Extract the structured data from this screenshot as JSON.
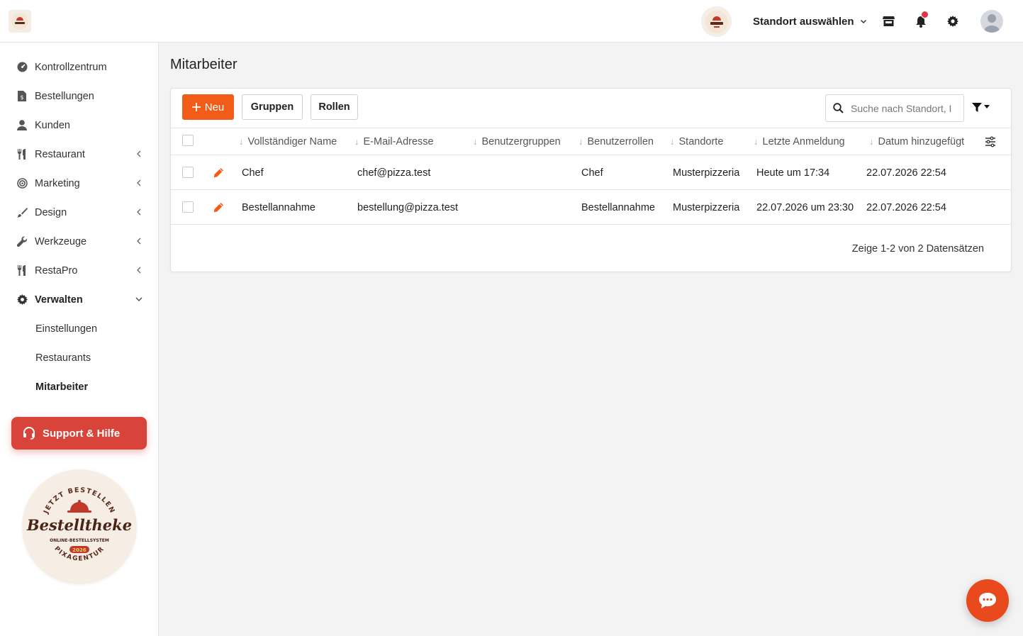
{
  "header": {
    "location_select_label": "Standort auswählen",
    "icons": [
      "store-icon",
      "bell-icon",
      "gear-icon",
      "user-avatar-icon"
    ],
    "notification_dot_color": "#dc3545"
  },
  "sidebar": {
    "items": [
      {
        "label": "Kontrollzentrum",
        "icon": "dashboard-icon"
      },
      {
        "label": "Bestellungen",
        "icon": "order-file-icon"
      },
      {
        "label": "Kunden",
        "icon": "user-icon"
      },
      {
        "label": "Restaurant",
        "icon": "utensils-icon"
      },
      {
        "label": "Marketing",
        "icon": "target-icon"
      },
      {
        "label": "Design",
        "icon": "brush-icon"
      },
      {
        "label": "Werkzeuge",
        "icon": "wrench-icon"
      },
      {
        "label": "RestaPro",
        "icon": "utensils-icon"
      },
      {
        "label": "Verwalten",
        "icon": "gear-icon"
      }
    ],
    "subitems": [
      {
        "label": "Einstellungen"
      },
      {
        "label": "Restaurants"
      },
      {
        "label": "Mitarbeiter"
      }
    ],
    "support_label": "Support & Hilfe",
    "badge": {
      "top_text": "JETZT BESTELLEN",
      "brand": "Bestelltheke",
      "subtitle": "ONLINE-BESTELLSYSTEM",
      "year": "2026",
      "bottom_text": "PIXAGENTUR"
    }
  },
  "main": {
    "title": "Mitarbeiter",
    "toolbar": {
      "new_label": "Neu",
      "groups_label": "Gruppen",
      "roles_label": "Rollen",
      "search_placeholder": "Suche nach Standort, I"
    },
    "table": {
      "columns": [
        "Vollständiger Name",
        "E-Mail-Adresse",
        "Benutzergruppen",
        "Benutzerrollen",
        "Standorte",
        "Letzte Anmeldung",
        "Datum hinzugefügt"
      ],
      "rows": [
        {
          "name": "Chef",
          "email": "chef@pizza.test",
          "groups": "",
          "roles": "Chef",
          "locations": "Musterpizzeria",
          "last_login": "Heute um 17:34",
          "date_added": "22.07.2026 22:54"
        },
        {
          "name": "Bestellannahme",
          "email": "bestellung@pizza.test",
          "groups": "",
          "roles": "Bestellannahme",
          "locations": "Musterpizzeria",
          "last_login": "22.07.2026 um 23:30",
          "date_added": "22.07.2026 22:54"
        }
      ],
      "footer": "Zeige 1-2 von 2 Datensätzen"
    }
  },
  "colors": {
    "accent": "#f25c19",
    "support": "#d9443a",
    "chat": "#e8491d"
  }
}
